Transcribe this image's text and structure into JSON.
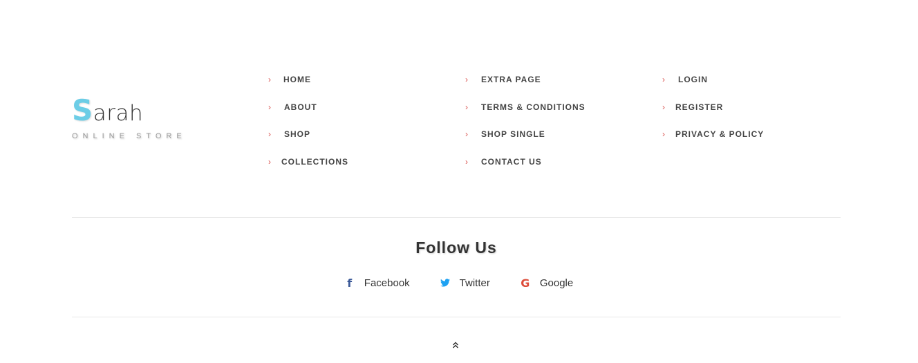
{
  "logo": {
    "initial": "S",
    "rest": "arah",
    "subtitle": "ONLINE STORE"
  },
  "footer_links": {
    "col1": [
      "HOME",
      "ABOUT",
      "SHOP",
      "COLLECTIONS"
    ],
    "col2": [
      "EXTRA PAGE",
      "TERMS & CONDITIONS",
      "SHOP SINGLE",
      "CONTACT US"
    ],
    "col3": [
      "LOGIN",
      "REGISTER",
      "PRIVACY & POLICY"
    ]
  },
  "follow": {
    "title": "Follow Us",
    "facebook": "Facebook",
    "twitter": "Twitter",
    "google": "Google"
  },
  "icons": {
    "chevron": "chevron-right-icon",
    "facebook": "facebook-icon",
    "twitter": "twitter-icon",
    "google": "google-icon",
    "back_to_top": "double-chevron-up-icon"
  },
  "colors": {
    "accent": "#6ccde6",
    "chevron": "#d9534f",
    "facebook": "#3b5998",
    "twitter": "#1da1f2",
    "google": "#dd4b39"
  }
}
